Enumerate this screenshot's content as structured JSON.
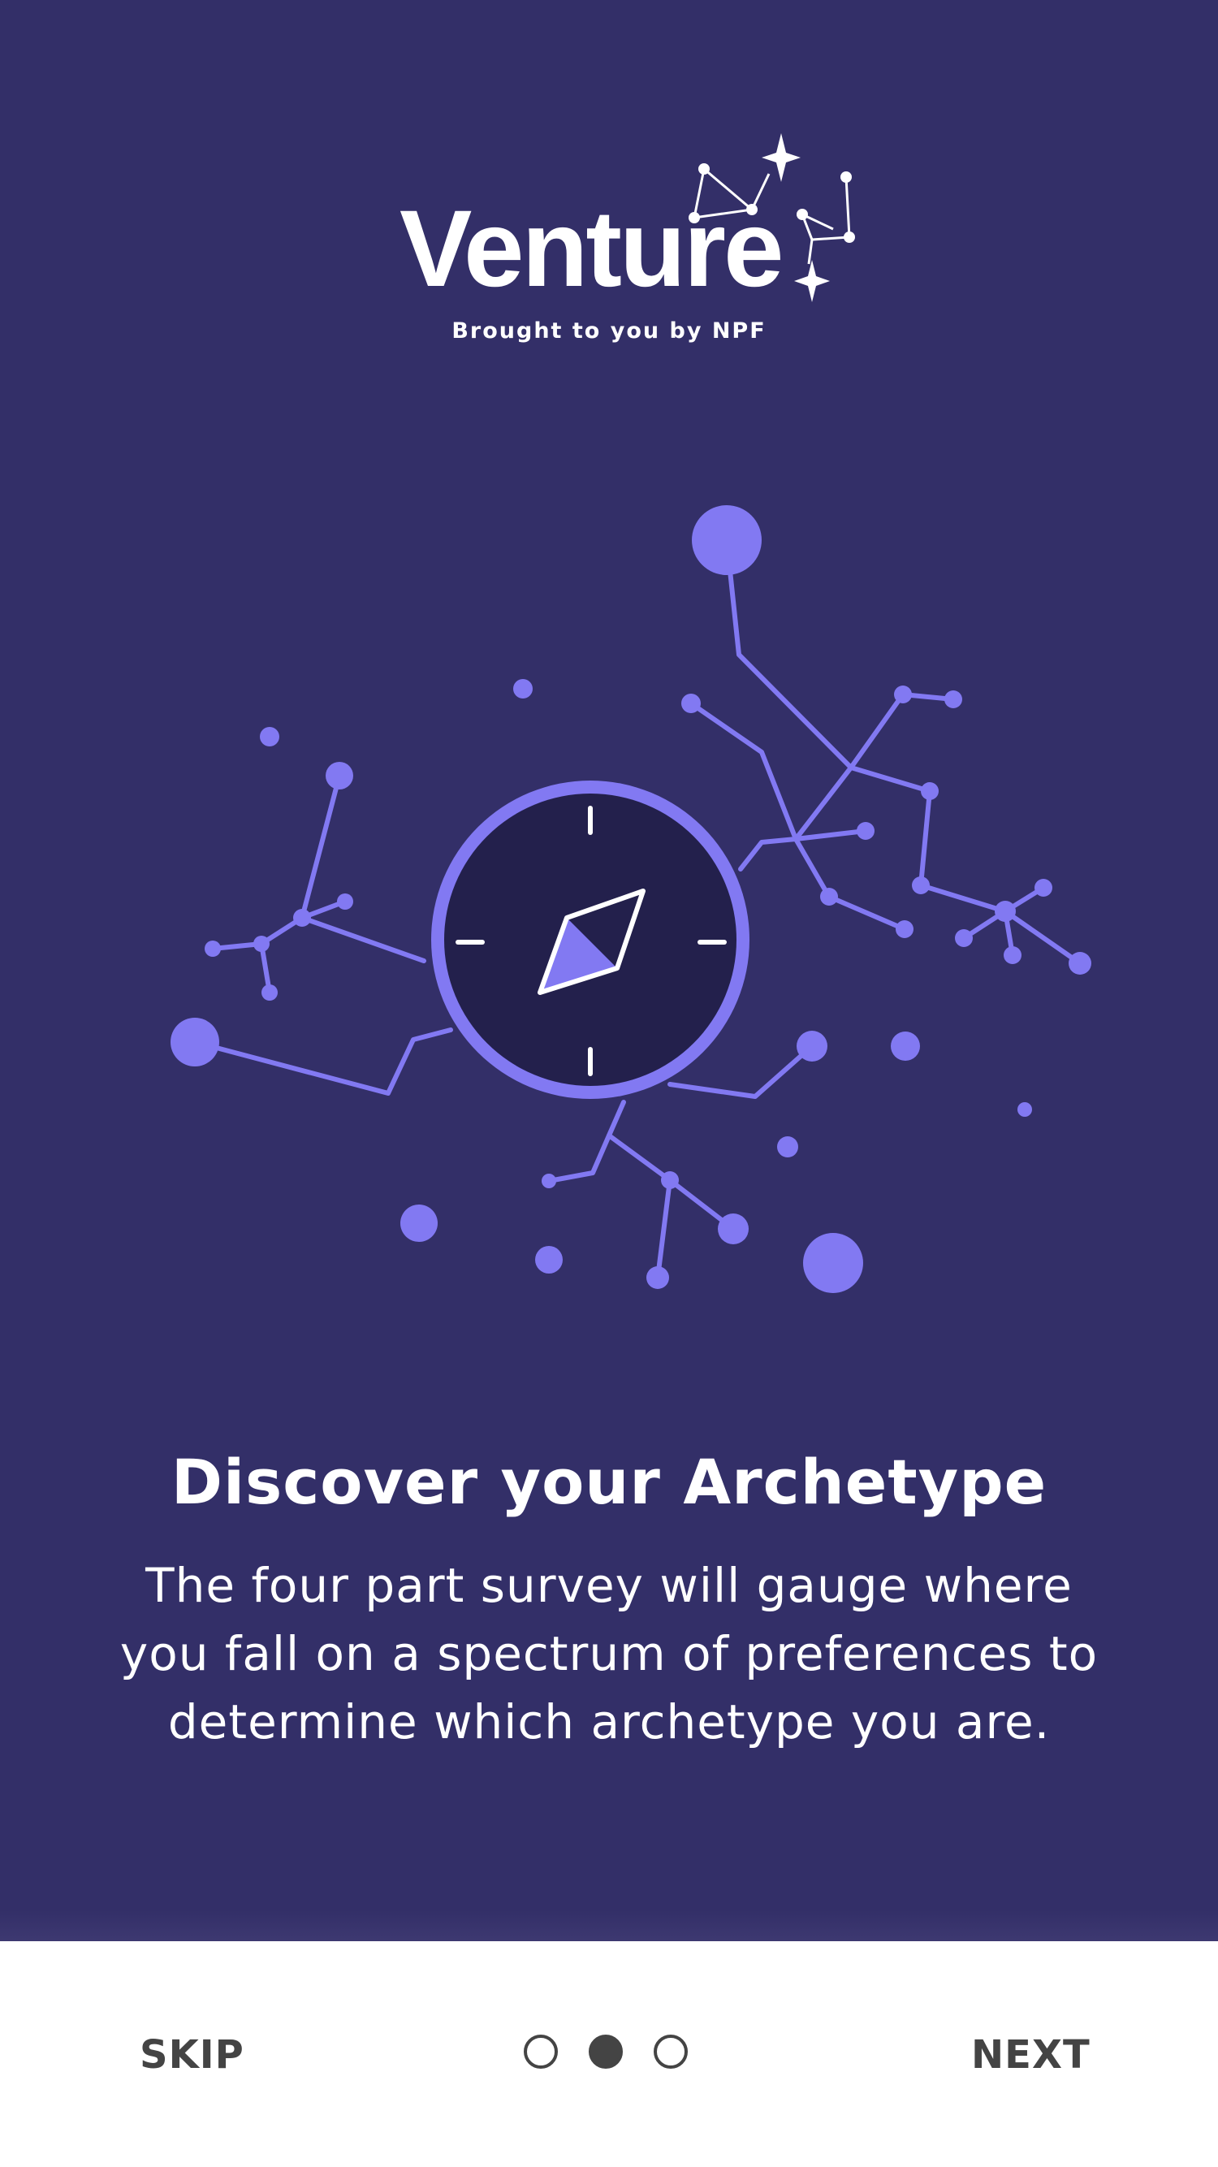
{
  "app": {
    "logo_text": "Venture",
    "tagline": "Brought to you by NPF"
  },
  "onboarding": {
    "headline": "Discover your Archetype",
    "description": "The four part survey will gauge where you fall on a spectrum of preferences to determine which archetype you are.",
    "illustration": "compass-constellation-icon"
  },
  "pager": {
    "total_pages": 3,
    "active_page": 2
  },
  "nav": {
    "skip_label": "SKIP",
    "next_label": "NEXT"
  },
  "colors": {
    "background": "#332f68",
    "accent": "#8279f2",
    "compass_face": "#23204c",
    "bottom_bar": "#ffffff",
    "nav_text": "#444444"
  }
}
